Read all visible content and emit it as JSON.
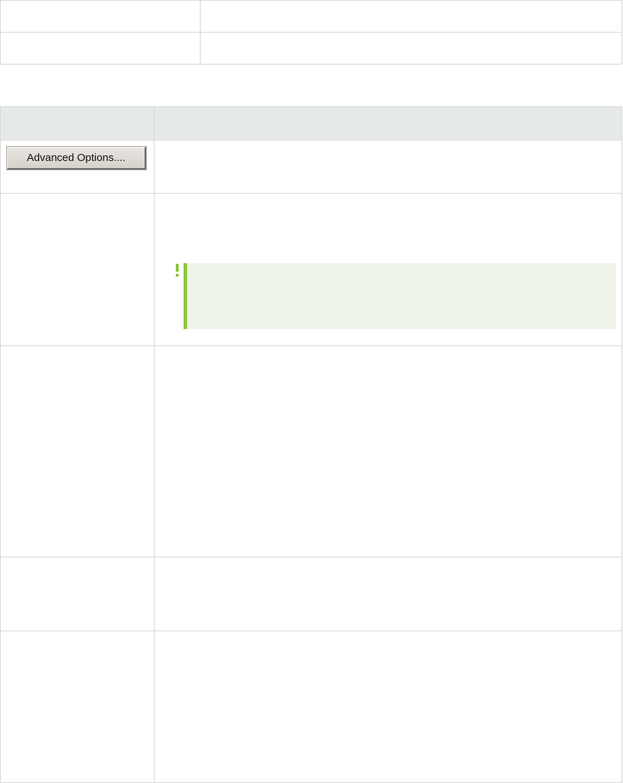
{
  "toolbar": {
    "advanced_options_label": "Advanced Options...."
  },
  "colors": {
    "header_bg": "#e6e9ea",
    "border": "#d6d6d6",
    "note_bg": "#eef5e8",
    "note_accent": "#8cc63f",
    "button_face": "#dcd8d2"
  },
  "icons": {
    "note": "exclamation-icon"
  }
}
